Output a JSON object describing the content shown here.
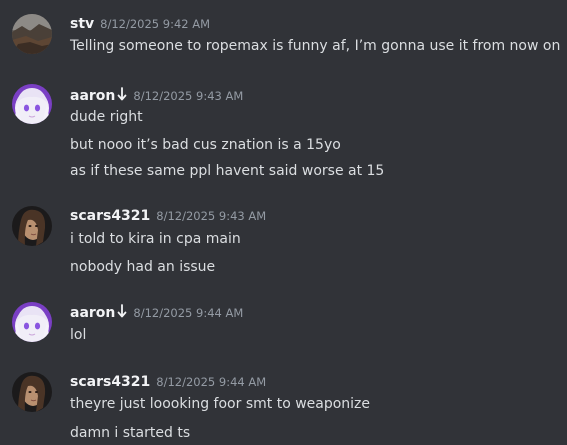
{
  "messages": [
    {
      "username": "stv",
      "timestamp": "8/12/2025 9:42 AM",
      "avatar": "landscape-avatar",
      "has_badge": false,
      "lines": [
        "Telling someone to ropemax is funny af, I’m gonna use it from now on"
      ]
    },
    {
      "username": "aaron",
      "timestamp": "8/12/2025 9:43 AM",
      "avatar": "anime-purple-avatar",
      "has_badge": true,
      "badge_icon": "arrow-down-icon",
      "lines": [
        "dude right",
        "but nooo it’s bad cus znation is a 15yo",
        "as if these same ppl havent said worse at 15"
      ]
    },
    {
      "username": "scars4321",
      "timestamp": "8/12/2025 9:43 AM",
      "avatar": "photo-avatar",
      "has_badge": false,
      "lines": [
        "i told to kira in cpa main",
        "nobody had an issue"
      ]
    },
    {
      "username": "aaron",
      "timestamp": "8/12/2025 9:44 AM",
      "avatar": "anime-purple-avatar",
      "has_badge": true,
      "badge_icon": "arrow-down-icon",
      "lines": [
        "lol"
      ]
    },
    {
      "username": "scars4321",
      "timestamp": "8/12/2025 9:44 AM",
      "avatar": "photo-avatar",
      "has_badge": false,
      "lines": [
        "theyre just loooking foor smt to weaponize",
        "damn i started ts"
      ]
    }
  ],
  "colors": {
    "background": "#313338",
    "username": "#f2f3f5",
    "timestamp": "#949ba4",
    "message_text": "#dbdee1"
  }
}
